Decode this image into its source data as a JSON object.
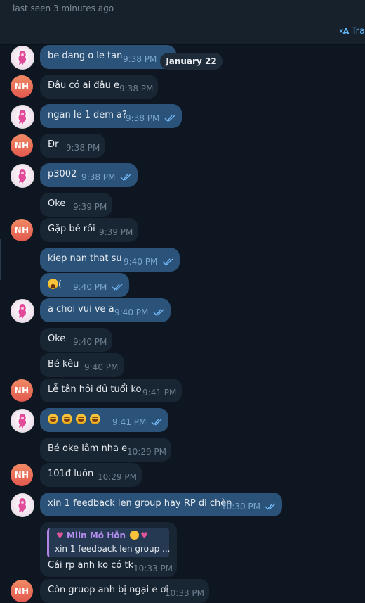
{
  "header": {
    "last_seen": "last seen 3 minutes ago",
    "translate_label": "Tra"
  },
  "date_chip": "January 22",
  "messages": [
    {
      "text": "be dang o le tan",
      "time": "9:38 PM"
    },
    {
      "text": "Đâu có ai đâu e",
      "time": "9:38 PM"
    },
    {
      "text": "ngan le 1 dem a?",
      "time": "9:38 PM"
    },
    {
      "text": "Đr",
      "time": "9:38 PM"
    },
    {
      "text": "p3002",
      "time": "9:38 PM"
    },
    {
      "text": "Oke",
      "time": "9:39 PM"
    },
    {
      "text": "Gặp bé rồi",
      "time": "9:39 PM"
    },
    {
      "text": "kiep nan that su",
      "time": "9:40 PM"
    },
    {
      "text": "(",
      "time": "9:40 PM"
    },
    {
      "text": "a choi vui ve a",
      "time": "9:40 PM"
    },
    {
      "text": "Oke",
      "time": "9:40 PM"
    },
    {
      "text": "Bé kêu",
      "time": "9:40 PM"
    },
    {
      "text": "Lễ tân hỏi đủ tuổi ko",
      "time": "9:41 PM"
    },
    {
      "text": "",
      "time": "9:41 PM"
    },
    {
      "text": "Bé oke lắm nha e",
      "time": "10:29 PM"
    },
    {
      "text": "101đ luôn",
      "time": "10:29 PM"
    },
    {
      "text": "xin 1 feedback len group hay RP di chèn",
      "time": "10:30 PM"
    },
    {
      "text": "Cái rp anh ko có tk",
      "time": "10:33 PM",
      "reply_name": "Miin Mỏ Hỗn",
      "reply_text": "xin 1 feedback len group ..."
    },
    {
      "text": "Còn gruop anh bị ngại e ơi",
      "time": "10:33 PM"
    }
  ],
  "avatar_initials": "NH",
  "colors": {
    "background": "#0e1621",
    "incoming_bubble": "#182533",
    "outgoing_bubble": "#2b5278",
    "nh_avatar": "#e8654f",
    "accent": "#5eb5f7",
    "reply_name": "#b58cf0"
  }
}
